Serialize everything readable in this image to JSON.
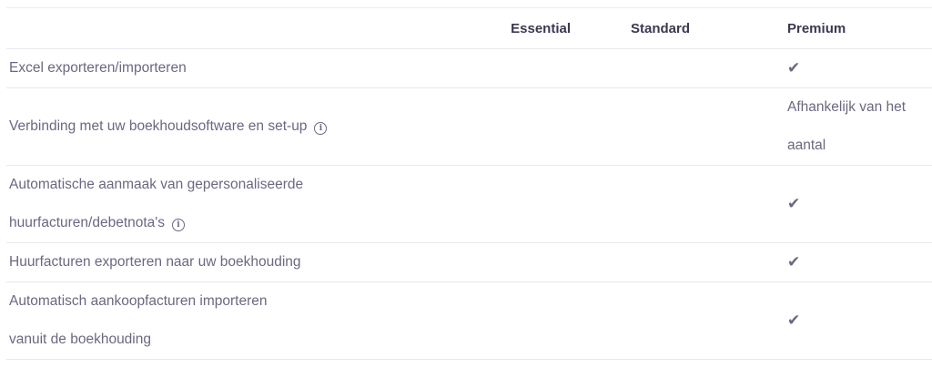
{
  "plans": {
    "essential": "Essential",
    "standard": "Standard",
    "premium": "Premium"
  },
  "rows": [
    {
      "feature_lines": [
        "Excel exporteren/importeren"
      ],
      "info": false,
      "premium_check": "✔"
    },
    {
      "feature_lines": [
        "Verbinding met uw boekhoudsoftware en set-up"
      ],
      "info": true,
      "premium_lines": [
        "Afhankelijk van het",
        "aantal"
      ]
    },
    {
      "feature_lines": [
        "Automatische aanmaak van gepersonaliseerde",
        "huurfacturen/debetnota's"
      ],
      "info": true,
      "premium_check": "✔"
    },
    {
      "feature_lines": [
        "Huurfacturen exporteren naar uw boekhouding"
      ],
      "info": false,
      "premium_check": "✔"
    },
    {
      "feature_lines": [
        "Automatisch aankoopfacturen importeren",
        "vanuit de boekhouding"
      ],
      "info": false,
      "premium_check": "✔"
    }
  ],
  "icons": {
    "info": "info-circle-icon",
    "check": "check-icon"
  },
  "colors": {
    "text": "#6b6880",
    "header": "#3b3950",
    "border": "#e8e8ee"
  }
}
